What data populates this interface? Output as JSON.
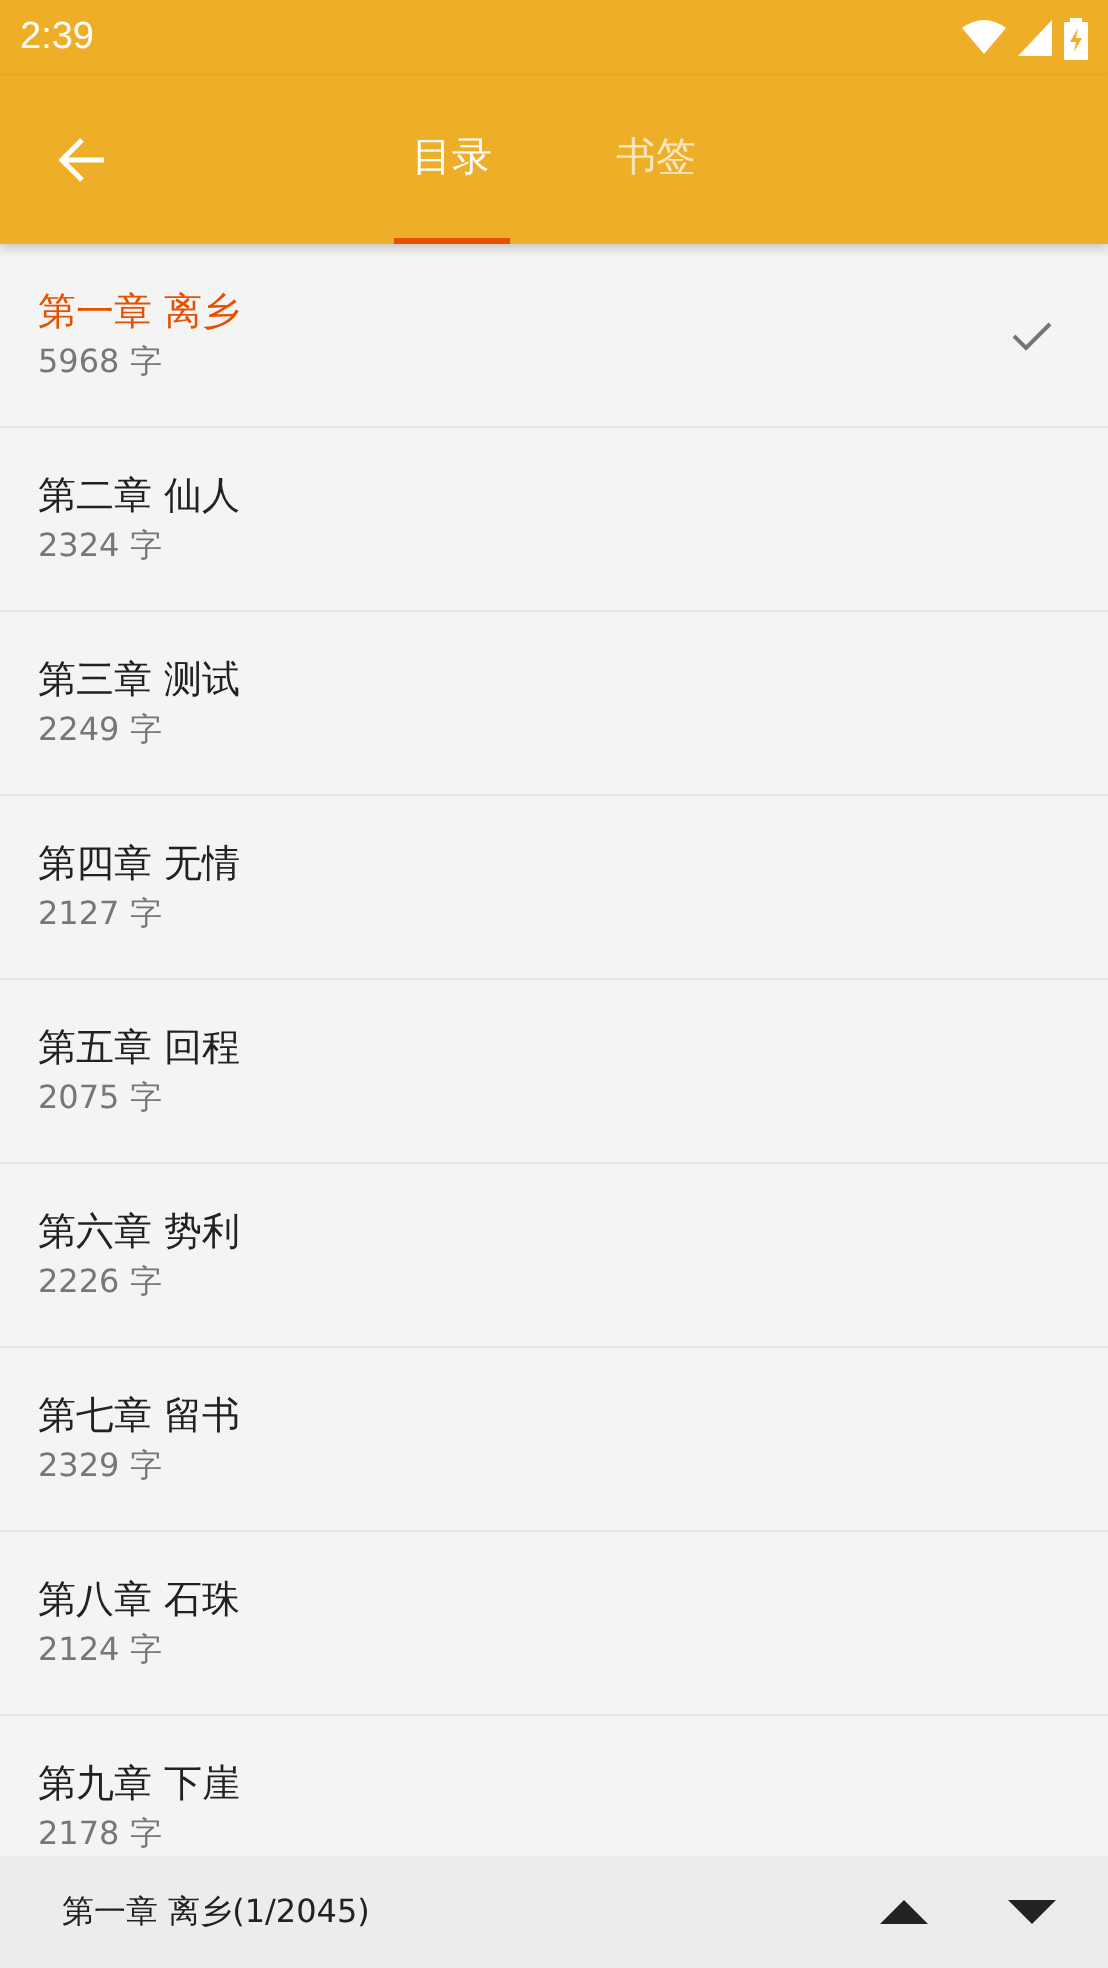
{
  "status_bar": {
    "time": "2:39"
  },
  "tabs": [
    {
      "label": "目录",
      "selected": true
    },
    {
      "label": "书签",
      "selected": false
    }
  ],
  "chapters": [
    {
      "title": "第一章 离乡",
      "words": "5968 字",
      "selected": true
    },
    {
      "title": "第二章 仙人",
      "words": "2324 字",
      "selected": false
    },
    {
      "title": "第三章 测试",
      "words": "2249 字",
      "selected": false
    },
    {
      "title": "第四章 无情",
      "words": "2127 字",
      "selected": false
    },
    {
      "title": "第五章 回程",
      "words": "2075 字",
      "selected": false
    },
    {
      "title": "第六章 势利",
      "words": "2226 字",
      "selected": false
    },
    {
      "title": "第七章 留书",
      "words": "2329 字",
      "selected": false
    },
    {
      "title": "第八章 石珠",
      "words": "2124 字",
      "selected": false
    },
    {
      "title": "第九章 下崖",
      "words": "2178 字",
      "selected": false
    }
  ],
  "bottom_bar": {
    "current": "第一章 离乡(1/2045)"
  }
}
